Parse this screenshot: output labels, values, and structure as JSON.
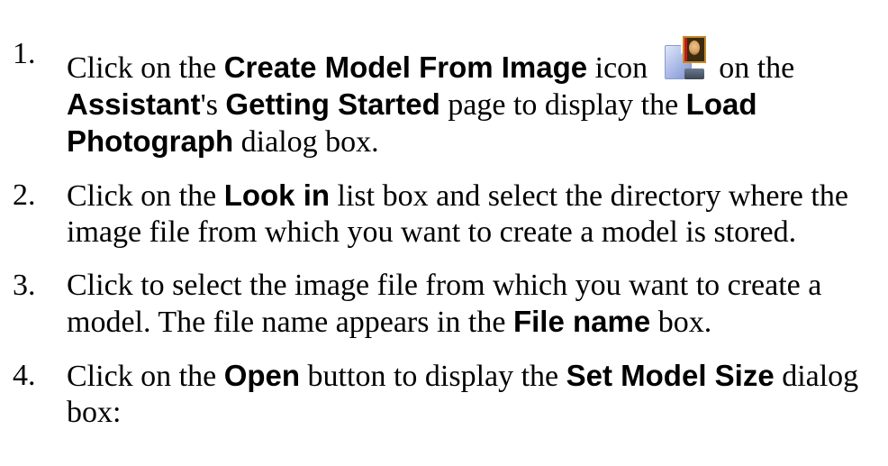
{
  "steps": [
    {
      "number": "1.",
      "parts": {
        "t1": "Click on the ",
        "b1": "Create Model From Image",
        "t2": " icon ",
        "icon": "create-model-from-image-icon",
        "t3": " on the ",
        "b2": "Assistant",
        "t4": "'s ",
        "b3": "Getting Started",
        "t5": " page to display the ",
        "b4": "Load Photograph",
        "t6": " dialog box."
      }
    },
    {
      "number": "2.",
      "parts": {
        "t1": "Click on the ",
        "b1": "Look in",
        "t2": " list box and select the directory where the image file from which you want to create a model is stored."
      }
    },
    {
      "number": "3.",
      "parts": {
        "t1": "Click to select the image file from which you want to create a model. The file name appears in the ",
        "b1": "File name",
        "t2": " box."
      }
    },
    {
      "number": "4.",
      "parts": {
        "t1": "Click on the ",
        "b1": "Open",
        "t2": " button to display the ",
        "b2": "Set Model Size",
        "t3": " dialog box:"
      }
    }
  ]
}
